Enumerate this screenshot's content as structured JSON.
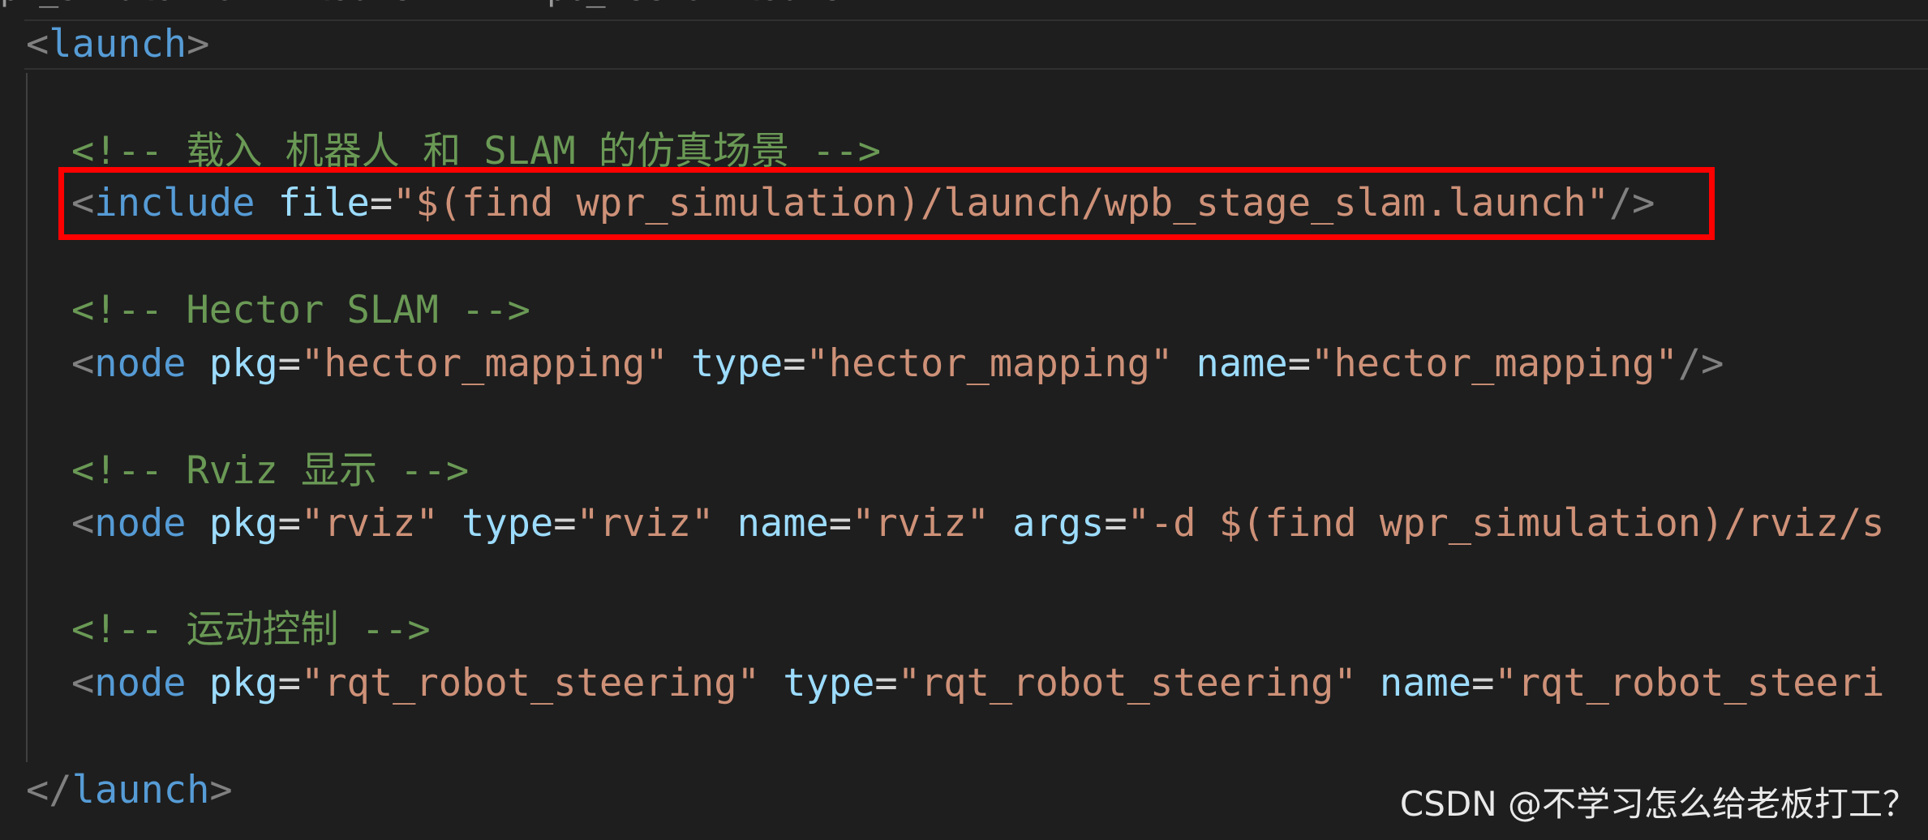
{
  "breadcrumb": "pr_simulation > launch > ≡ wpb_hector.launch",
  "code": {
    "open_launch": {
      "lt": "<",
      "tag": "launch",
      "gt": ">"
    },
    "comment1": "<!-- 载入 机器人 和 SLAM 的仿真场景 -->",
    "include": {
      "lt": "<",
      "tag": "include",
      "attr_file": "file",
      "eq": "=",
      "val_file": "\"$(find wpr_simulation)/launch/wpb_stage_slam.launch\"",
      "close": "/>"
    },
    "comment2": "<!-- Hector SLAM -->",
    "node_hector": {
      "lt": "<",
      "tag": "node",
      "attr_pkg": "pkg",
      "val_pkg": "\"hector_mapping\"",
      "attr_type": "type",
      "val_type": "\"hector_mapping\"",
      "attr_name": "name",
      "val_name": "\"hector_mapping\"",
      "close": "/>"
    },
    "comment3": "<!-- Rviz 显示 -->",
    "node_rviz": {
      "lt": "<",
      "tag": "node",
      "attr_pkg": "pkg",
      "val_pkg": "\"rviz\"",
      "attr_type": "type",
      "val_type": "\"rviz\"",
      "attr_name": "name",
      "val_name": "\"rviz\"",
      "attr_args": "args",
      "val_args": "\"-d $(find wpr_simulation)/rviz/s"
    },
    "comment4": "<!-- 运动控制 -->",
    "node_rqt": {
      "lt": "<",
      "tag": "node",
      "attr_pkg": "pkg",
      "val_pkg": "\"rqt_robot_steering\"",
      "attr_type": "type",
      "val_type": "\"rqt_robot_steering\"",
      "attr_name": "name",
      "val_name": "\"rqt_robot_steeri"
    },
    "close_launch": {
      "lt": "</",
      "tag": "launch",
      "gt": ">"
    }
  },
  "watermark": "CSDN @不学习怎么给老板打工？",
  "colors": {
    "background": "#1e1e1e",
    "comment": "#6a9955",
    "bracket": "#808080",
    "tag": "#569cd6",
    "attribute": "#9cdcfe",
    "string": "#ce9178",
    "highlight_box": "#ff0000"
  }
}
